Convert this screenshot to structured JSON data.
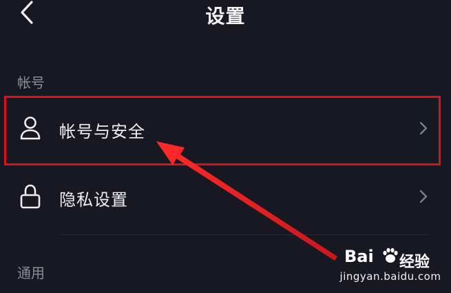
{
  "header": {
    "title": "设置",
    "back_icon": "chevron-left-icon"
  },
  "sections": [
    {
      "label": "帐号",
      "items": [
        {
          "label": "帐号与安全",
          "icon": "user-icon",
          "highlighted": true
        },
        {
          "label": "隐私设置",
          "icon": "lock-icon",
          "highlighted": false
        }
      ]
    },
    {
      "label": "通用",
      "items": []
    }
  ],
  "annotation": {
    "box_color": "#e0101a",
    "arrow_color": "#f03030"
  },
  "watermark": {
    "logo_text": "Bai",
    "logo_suffix": "经验",
    "url": "jingyan.baidu.com"
  },
  "colors": {
    "background": "#171821",
    "text_primary": "#f0f0f2",
    "text_secondary": "#8d8e96"
  }
}
